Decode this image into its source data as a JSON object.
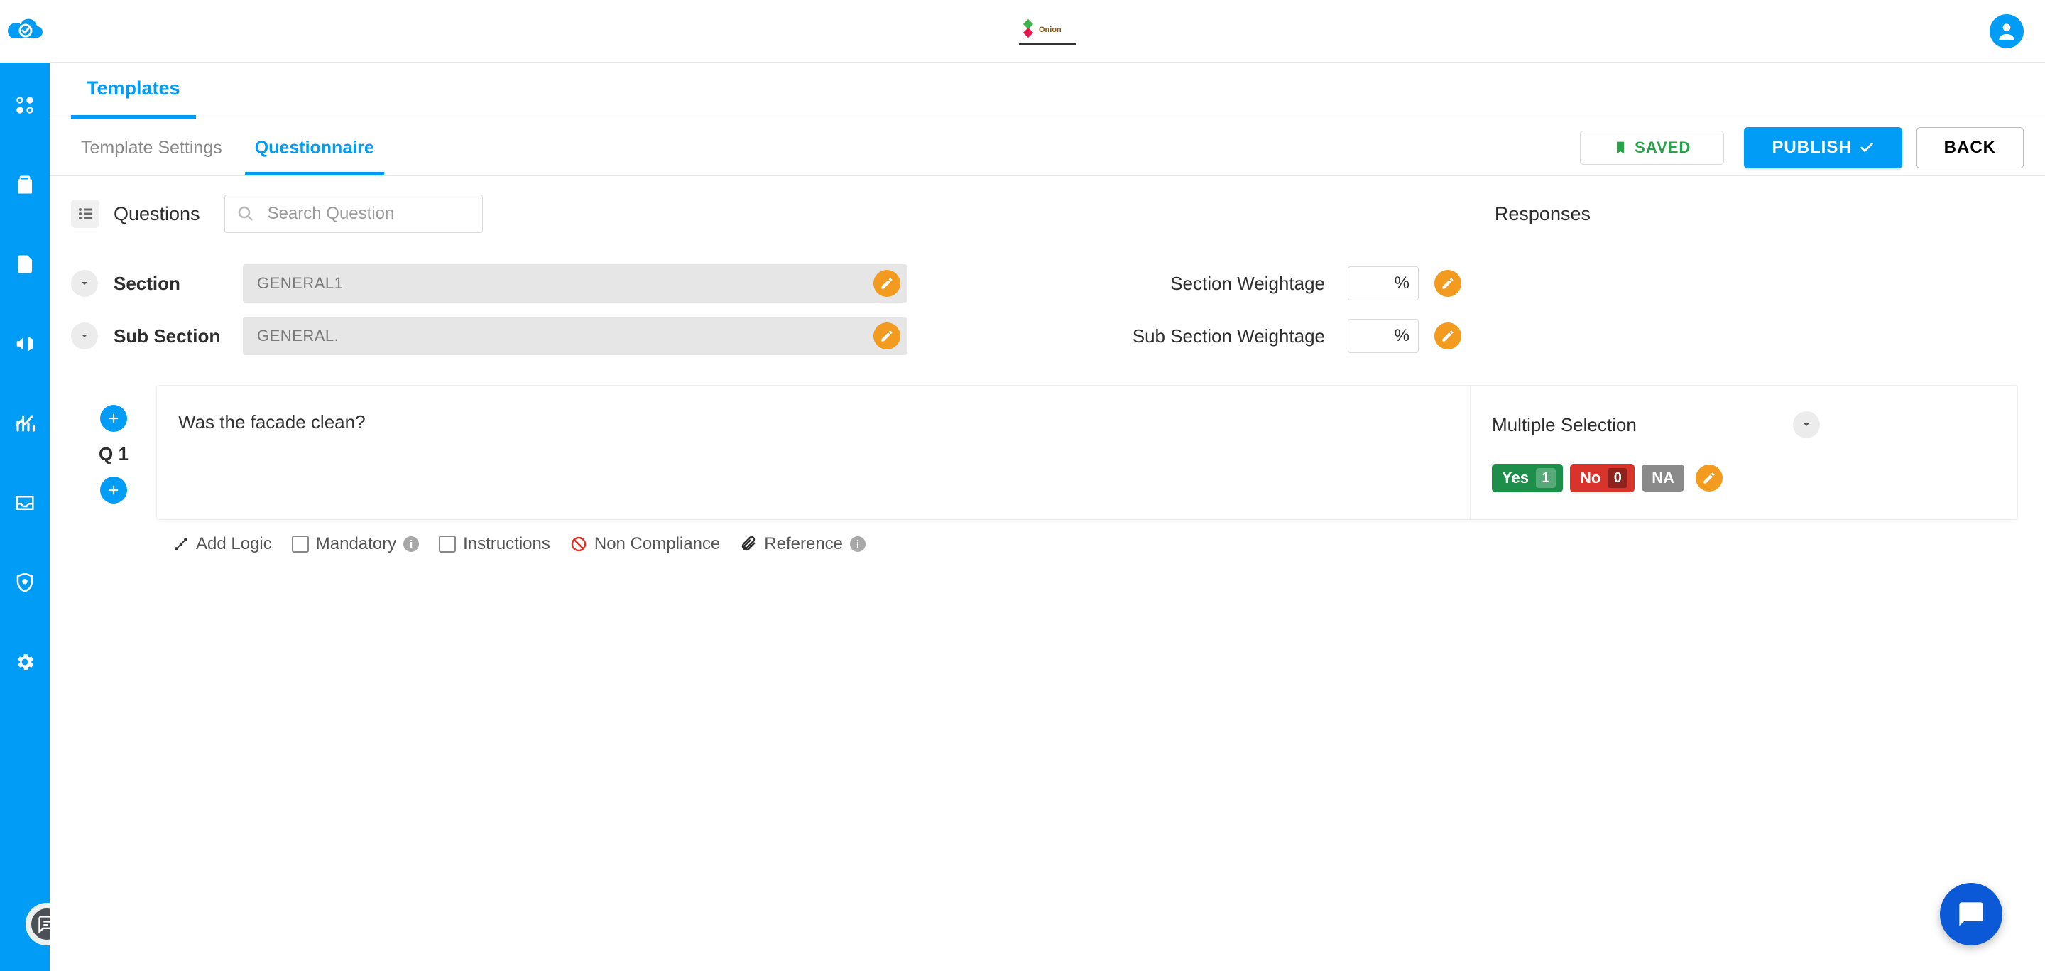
{
  "header": {
    "tab_primary": "Templates"
  },
  "subheader": {
    "template_settings": "Template Settings",
    "questionnaire": "Questionnaire",
    "saved": "SAVED",
    "publish": "PUBLISH",
    "back": "BACK"
  },
  "filters": {
    "questions_label": "Questions",
    "search_placeholder": "Search Question",
    "responses_label": "Responses"
  },
  "section": {
    "section_label": "Section",
    "section_name": "GENERAL1",
    "section_weightage_label": "Section Weightage",
    "weightage_unit": "%",
    "sub_label": "Sub Section",
    "sub_name": "GENERAL.",
    "sub_weightage_label": "Sub Section Weightage"
  },
  "question": {
    "q_label": "Q 1",
    "text": "Was the facade clean?",
    "response_type": "Multiple Selection",
    "answers": {
      "yes_label": "Yes",
      "yes_value": "1",
      "no_label": "No",
      "no_value": "0",
      "na_label": "NA"
    }
  },
  "footer": {
    "add_logic": "Add Logic",
    "mandatory": "Mandatory",
    "instructions": "Instructions",
    "non_compliance": "Non Compliance",
    "reference": "Reference"
  }
}
